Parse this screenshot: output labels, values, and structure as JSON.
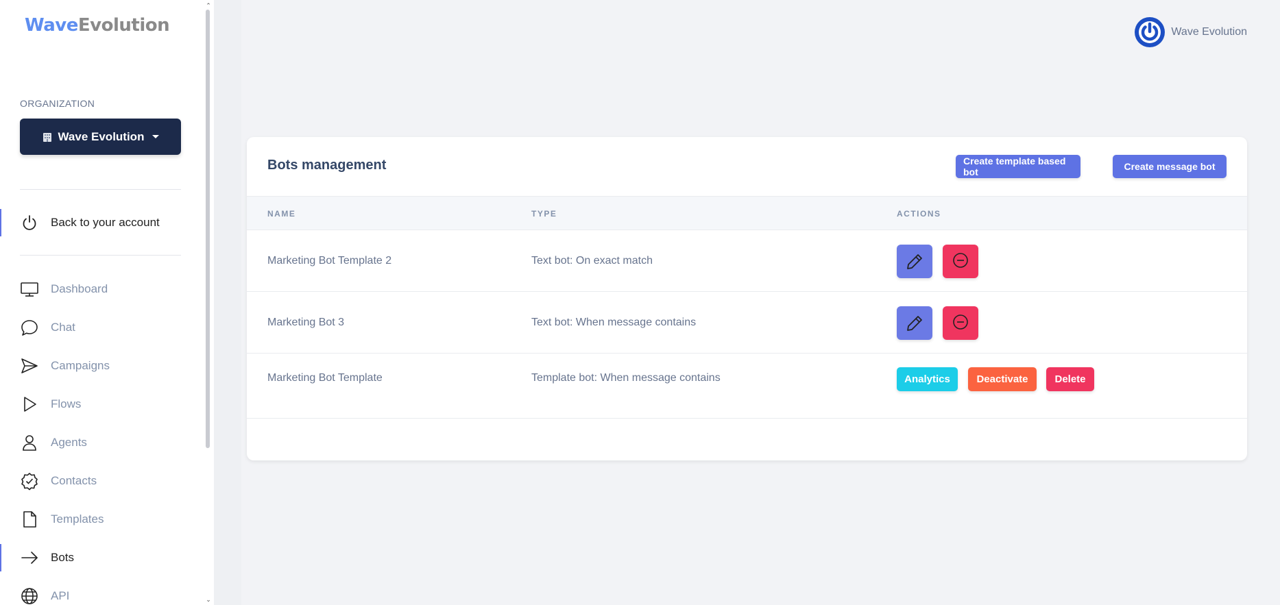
{
  "brand": {
    "part1": "Wave",
    "part2": "Evolution"
  },
  "sidebar": {
    "org_label": "ORGANIZATION",
    "org_button": "Wave Evolution",
    "back_link": "Back to your account",
    "items": [
      {
        "label": "Dashboard",
        "icon": "monitor-icon"
      },
      {
        "label": "Chat",
        "icon": "chat-bubble-icon"
      },
      {
        "label": "Campaigns",
        "icon": "send-icon"
      },
      {
        "label": "Flows",
        "icon": "play-icon"
      },
      {
        "label": "Agents",
        "icon": "user-icon"
      },
      {
        "label": "Contacts",
        "icon": "badge-check-icon"
      },
      {
        "label": "Templates",
        "icon": "file-icon"
      },
      {
        "label": "Bots",
        "icon": "arrow-right-icon",
        "active": true
      },
      {
        "label": "API",
        "icon": "globe-icon"
      }
    ]
  },
  "header": {
    "user_name": "Wave Evolution"
  },
  "card": {
    "title": "Bots management",
    "btn_template": "Create template based bot",
    "btn_message": "Create message bot",
    "columns": [
      "NAME",
      "TYPE",
      "ACTIONS"
    ],
    "rows": [
      {
        "name": "Marketing Bot Template 2",
        "type": "Text bot: On exact match"
      },
      {
        "name": "Marketing Bot 3",
        "type": "Text bot: When message contains"
      },
      {
        "name": "Marketing Bot Template",
        "type": "Template bot: When message contains"
      }
    ],
    "action_labels": {
      "analytics": "Analytics",
      "deactivate": "Deactivate",
      "delete": "Delete"
    }
  },
  "colors": {
    "accent": "#5e72e4",
    "danger": "#f0355f",
    "info": "#1ccde8",
    "warning": "#fb6340",
    "dark": "#1c2a4a"
  }
}
